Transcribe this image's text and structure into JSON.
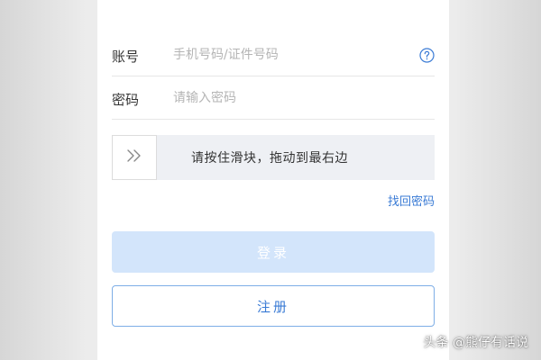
{
  "form": {
    "account": {
      "label": "账号",
      "placeholder": "手机号码/证件号码",
      "value": ""
    },
    "password": {
      "label": "密码",
      "placeholder": "请输入密码",
      "value": ""
    },
    "help_icon": "question-circle-icon",
    "slider": {
      "handle_icon": "double-chevron-right-icon",
      "text": "请按住滑块，拖动到最右边",
      "progress": 0
    },
    "forgot_password_label": "找回密码",
    "login_label": "登录",
    "register_label": "注册"
  },
  "watermark": "头条 @熊仔有话说",
  "colors": {
    "accent": "#3a7bd5",
    "login_disabled_bg": "#d3e5fb",
    "register_border": "#7eaee6",
    "slider_bg": "#eef0f4"
  }
}
